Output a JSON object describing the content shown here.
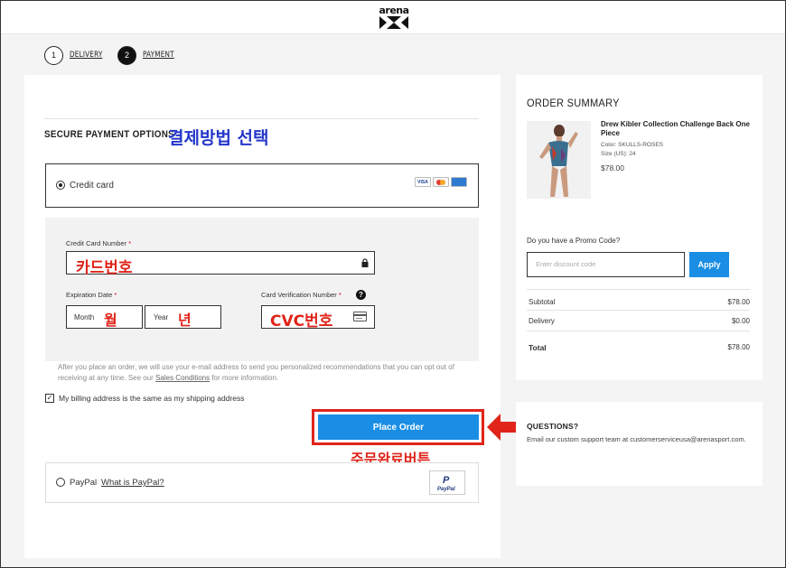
{
  "header": {
    "logo_text": "arena"
  },
  "steps": [
    {
      "number": "1",
      "label": "DELIVERY",
      "active": false
    },
    {
      "number": "2",
      "label": "PAYMENT",
      "active": true
    }
  ],
  "payment": {
    "section_title": "SECURE PAYMENT OPTIONS",
    "annotation_title": "결제방법 선택",
    "credit_card": {
      "label": "Credit card",
      "selected": true,
      "card_logos": [
        "VISA",
        "MasterCard",
        "AMEX"
      ],
      "number_label": "Credit Card Number",
      "number_annotation": "카드번호",
      "expiration_label": "Expiration Date",
      "month_placeholder": "Month",
      "month_annotation": "월",
      "year_placeholder": "Year",
      "year_annotation": "년",
      "cvc_label": "Card Verification Number",
      "cvc_annotation": "CVC번호",
      "required_mark": "*",
      "help_glyph": "?"
    },
    "info_text_before_link": "After you place an order, we will use your e-mail address to send you personalized recommendations that you can opt out of receiving at any time. See our ",
    "info_link": "Sales Conditions",
    "info_text_after_link": " for more information.",
    "billing_same": {
      "label": "My billing address is the same as my shipping address",
      "checked": true,
      "check_glyph": "✓"
    },
    "place_order_label": "Place Order",
    "place_order_annotation": "주문완료버튼",
    "paypal": {
      "label": "PayPal",
      "link": "What is PayPal?",
      "selected": false,
      "logo_mark": "P",
      "logo_text": "PayPal"
    }
  },
  "summary": {
    "title": "ORDER SUMMARY",
    "product": {
      "name": "Drew Kibler Collection Challenge Back One Piece",
      "color": "Color:  SKULLS-ROSES",
      "size": "Size (US):  24",
      "price": "$78.00"
    },
    "promo_label": "Do you have a Promo Code?",
    "promo_placeholder": "Enter discount code",
    "apply_label": "Apply",
    "rows": [
      {
        "label": "Subtotal",
        "value": "$78.00"
      },
      {
        "label": "Delivery",
        "value": "$0.00"
      }
    ],
    "total": {
      "label": "Total",
      "value": "$78.00"
    }
  },
  "questions": {
    "title": "QUESTIONS?",
    "text": "Email our custom support team at customerserviceusa@arenasport.com."
  },
  "colors": {
    "accent_blue": "#1a8ee4",
    "annotation_red": "#e0241a",
    "annotation_blue": "#2336c9"
  },
  "icons": [
    "lock-icon",
    "help-icon",
    "cvc-card-icon",
    "red-arrow-icon"
  ]
}
